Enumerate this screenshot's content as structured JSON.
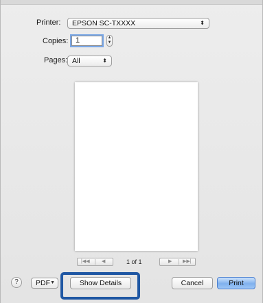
{
  "printer": {
    "label": "Printer:",
    "value": "EPSON SC-TXXXX"
  },
  "copies": {
    "label": "Copies:",
    "value": "1"
  },
  "pages": {
    "label": "Pages:",
    "value": "All"
  },
  "preview_nav": {
    "first": "|◀◀",
    "prev": "◀",
    "page_indicator": "1 of 1",
    "next": "▶",
    "last": "▶▶|"
  },
  "footer": {
    "help": "?",
    "pdf": "PDF",
    "show_details": "Show Details",
    "cancel": "Cancel",
    "print": "Print"
  },
  "colors": {
    "highlight": "#1f57a3",
    "primary_button": "#7fb1ee"
  }
}
